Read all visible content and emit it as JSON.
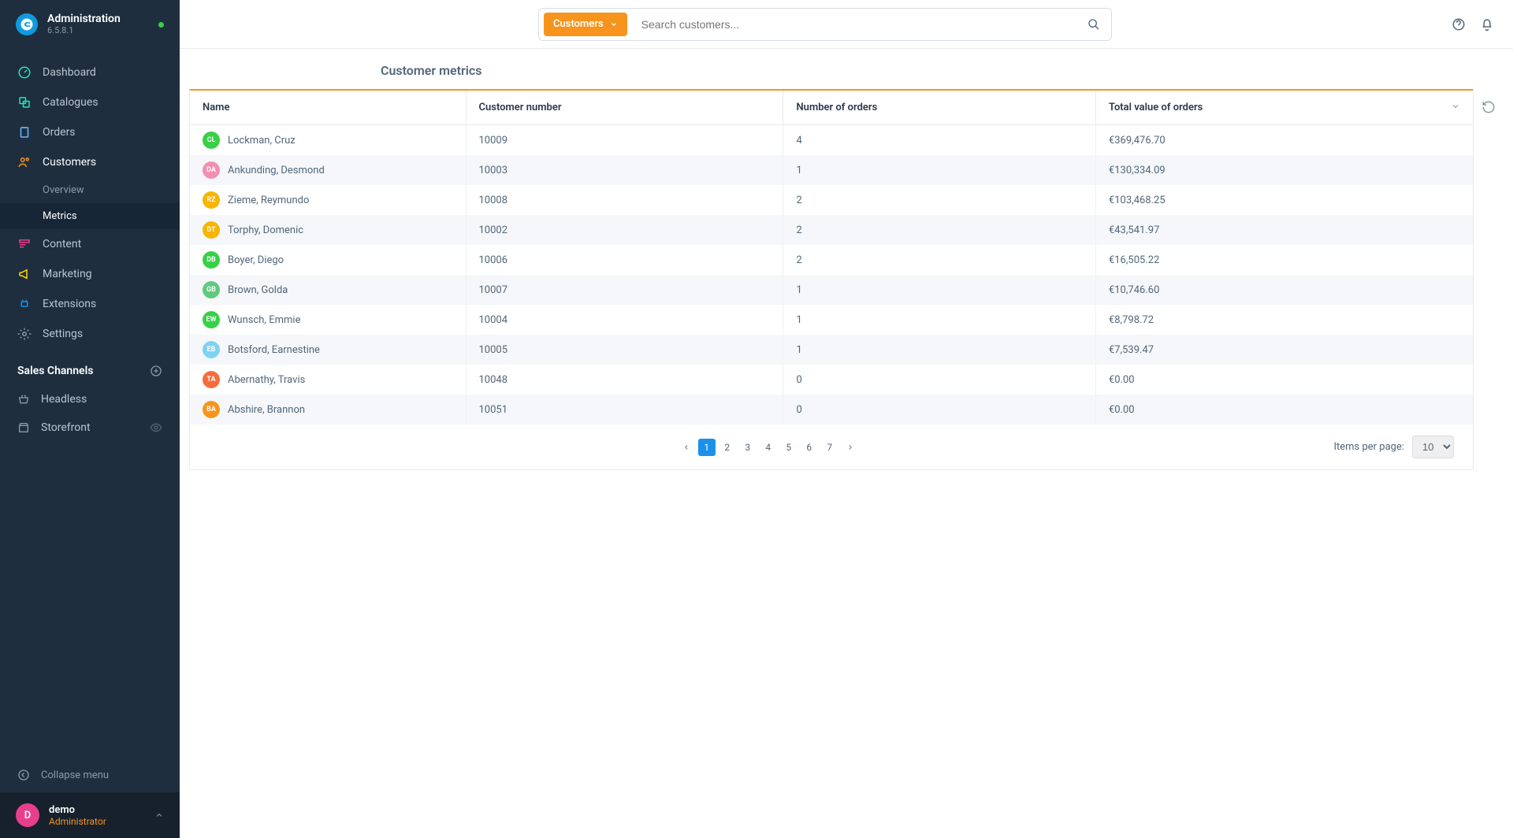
{
  "app": {
    "title": "Administration",
    "version": "6.5.8.1"
  },
  "nav": {
    "dashboard": "Dashboard",
    "catalogues": "Catalogues",
    "orders": "Orders",
    "customers": "Customers",
    "customers_sub": {
      "overview": "Overview",
      "metrics": "Metrics"
    },
    "content": "Content",
    "marketing": "Marketing",
    "extensions": "Extensions",
    "settings": "Settings"
  },
  "channels": {
    "header": "Sales Channels",
    "headless": "Headless",
    "storefront": "Storefront"
  },
  "collapse": "Collapse menu",
  "user": {
    "initial": "D",
    "name": "demo",
    "role": "Administrator"
  },
  "search": {
    "tag": "Customers",
    "placeholder": "Search customers..."
  },
  "page": {
    "title": "Customer metrics"
  },
  "table": {
    "columns": {
      "name": "Name",
      "number": "Customer number",
      "orders": "Number of orders",
      "total": "Total value of orders"
    },
    "rows": [
      {
        "initials": "CL",
        "color": "#37d046",
        "name": "Lockman, Cruz",
        "number": "10009",
        "orders": "4",
        "total": "€369,476.70"
      },
      {
        "initials": "DA",
        "color": "#f48fb1",
        "name": "Ankunding, Desmond",
        "number": "10003",
        "orders": "1",
        "total": "€130,334.09"
      },
      {
        "initials": "RZ",
        "color": "#f7b500",
        "name": "Zieme, Reymundo",
        "number": "10008",
        "orders": "2",
        "total": "€103,468.25"
      },
      {
        "initials": "DT",
        "color": "#f7b500",
        "name": "Torphy, Domenic",
        "number": "10002",
        "orders": "2",
        "total": "€43,541.97"
      },
      {
        "initials": "DB",
        "color": "#37d046",
        "name": "Boyer, Diego",
        "number": "10006",
        "orders": "2",
        "total": "€16,505.22"
      },
      {
        "initials": "GB",
        "color": "#5fc97e",
        "name": "Brown, Golda",
        "number": "10007",
        "orders": "1",
        "total": "€10,746.60"
      },
      {
        "initials": "EW",
        "color": "#37d046",
        "name": "Wunsch, Emmie",
        "number": "10004",
        "orders": "1",
        "total": "€8,798.72"
      },
      {
        "initials": "EB",
        "color": "#7fd3f0",
        "name": "Botsford, Earnestine",
        "number": "10005",
        "orders": "1",
        "total": "€7,539.47"
      },
      {
        "initials": "TA",
        "color": "#f76b3c",
        "name": "Abernathy, Travis",
        "number": "10048",
        "orders": "0",
        "total": "€0.00"
      },
      {
        "initials": "BA",
        "color": "#f7941d",
        "name": "Abshire, Brannon",
        "number": "10051",
        "orders": "0",
        "total": "€0.00"
      }
    ]
  },
  "pagination": {
    "pages": [
      "1",
      "2",
      "3",
      "4",
      "5",
      "6",
      "7"
    ],
    "per_page_label": "Items per page:",
    "per_page_value": "10"
  }
}
